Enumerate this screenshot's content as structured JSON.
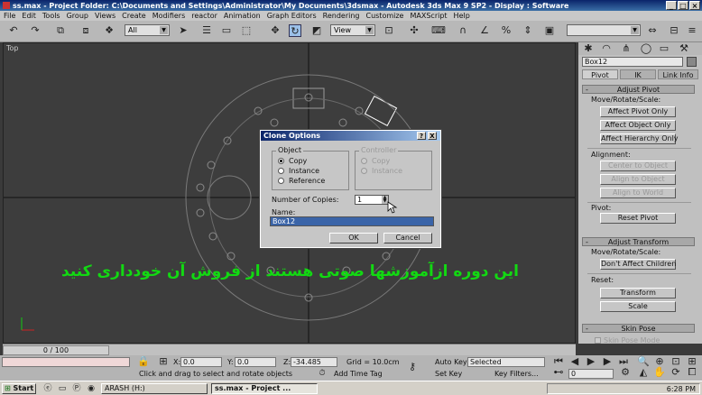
{
  "window": {
    "title": "ss.max - Project Folder: C:\\Documents and Settings\\Administrator\\My Documents\\3dsmax - Autodesk 3ds Max 9 SP2 - Display : Software"
  },
  "menu": [
    "File",
    "Edit",
    "Tools",
    "Group",
    "Views",
    "Create",
    "Modifiers",
    "reactor",
    "Animation",
    "Graph Editors",
    "Rendering",
    "Customize",
    "MAXScript",
    "Help"
  ],
  "toolbar": {
    "selection_filter": "All",
    "reference_coord": "View"
  },
  "viewport": {
    "label": "Top",
    "overlay_text": "این دوره ازآموزشها صوتی هستند از فروش آن خودداری کنید"
  },
  "dialog": {
    "title": "Clone Options",
    "help_btn": "?",
    "close_btn": "X",
    "object_group": "Object",
    "object_options": [
      "Copy",
      "Instance",
      "Reference"
    ],
    "controller_group": "Controller",
    "controller_options": [
      "Copy",
      "Instance"
    ],
    "copies_label": "Number of Copies:",
    "copies_value": "1",
    "name_label": "Name:",
    "name_value": "Box12",
    "ok": "OK",
    "cancel": "Cancel"
  },
  "command_panel": {
    "object_name": "Box12",
    "tabs": [
      "Pivot",
      "IK",
      "Link Info"
    ],
    "adjust_pivot": {
      "header": "Adjust Pivot",
      "move_label": "Move/Rotate/Scale:",
      "buttons": [
        "Affect Pivot Only",
        "Affect Object Only",
        "Affect Hierarchy Only"
      ],
      "alignment_label": "Alignment:",
      "align_buttons": [
        "Center to Object",
        "Align to Object",
        "Align to World"
      ],
      "pivot_label": "Pivot:",
      "reset_pivot": "Reset Pivot"
    },
    "adjust_transform": {
      "header": "Adjust Transform",
      "move_label": "Move/Rotate/Scale:",
      "dont_affect": "Don't Affect Children",
      "reset_label": "Reset:",
      "transform": "Transform",
      "scale": "Scale"
    },
    "skin_pose": {
      "header": "Skin Pose",
      "option": "Skin Pose Mode"
    }
  },
  "timeline": {
    "slider": "0 / 100"
  },
  "status": {
    "x_label": "X:",
    "x_value": "0.0",
    "y_label": "Y:",
    "y_value": "0.0",
    "z_label": "Z:",
    "z_value": "-34.485",
    "grid": "Grid = 10.0cm",
    "prompt": "Click and drag to select and rotate objects",
    "add_time_tag": "Add Time Tag",
    "auto_key": "Auto Key",
    "selected": "Selected",
    "set_key": "Set Key",
    "key_filters": "Key Filters...",
    "frame": "0"
  },
  "taskbar": {
    "start": "Start",
    "tasks": [
      "ARASH (H:)",
      "ss.max - Project ..."
    ],
    "clock": "6:28 PM"
  }
}
